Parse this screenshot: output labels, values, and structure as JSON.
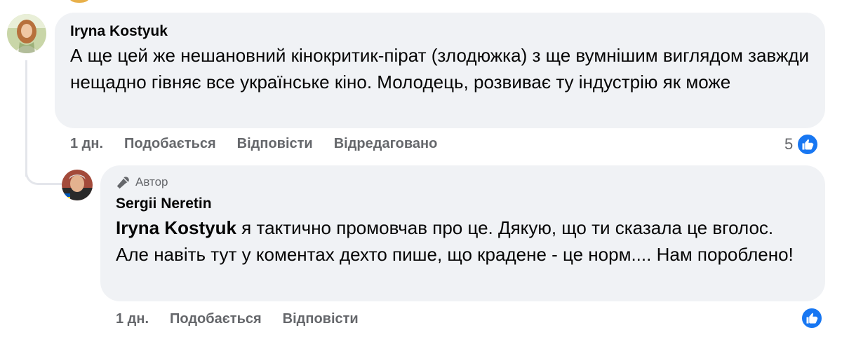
{
  "comment": {
    "author": "Iryna Kostyuk",
    "text": "А ще цей же нешановний кінокритик-пірат (злодюжка) з ще вумнішим виглядом завжди нещадно гівняє все українське кіно. Молодець, розвиває ту індустрію як може",
    "time": "1 дн.",
    "like_label": "Подобається",
    "reply_label": "Відповісти",
    "edited_label": "Відредаговано",
    "reaction_count": "5"
  },
  "reply": {
    "badge": "Автор",
    "author": "Sergii Neretin",
    "mention": "Iryna Kostyuk",
    "text": " я тактично промовчав про це. Дякую, що ти сказала це вголос. Але навіть тут у коментах дехто пише, що крадене - це норм.... Нам пороблено!",
    "time": "1 дн.",
    "like_label": "Подобається",
    "reply_label": "Відповісти"
  },
  "colors": {
    "bubble": "#f0f2f5",
    "meta_text": "#65676b",
    "like_blue": "#1877f2"
  },
  "icons": [
    "thumbs-up-icon",
    "microphone-icon"
  ]
}
